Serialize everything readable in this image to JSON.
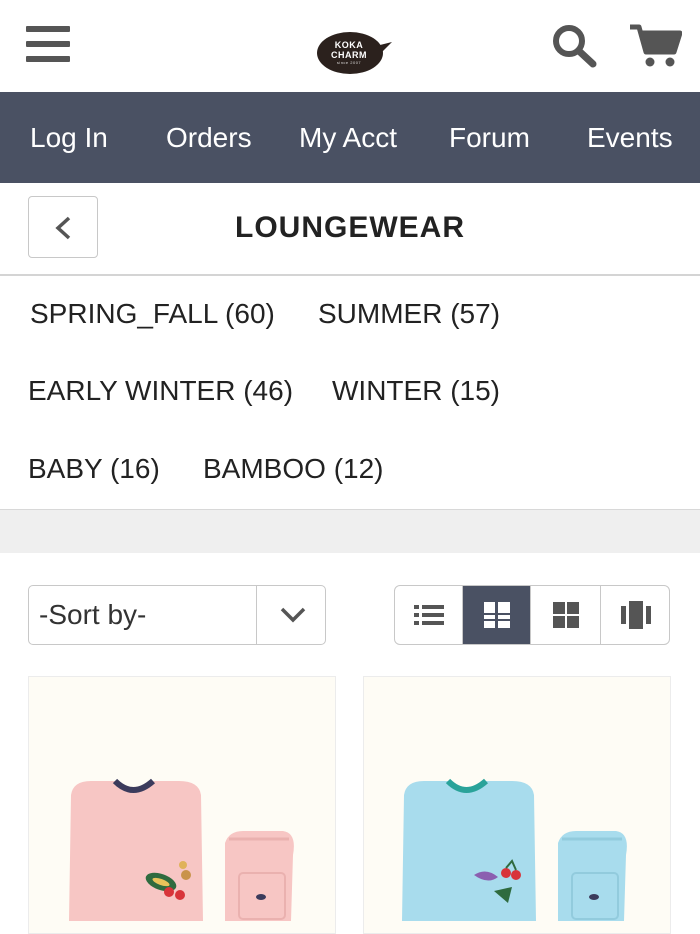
{
  "header": {
    "menu_icon": "hamburger-menu-icon",
    "logo": {
      "line1": "KOKA",
      "line2": "CHARM",
      "tagline": "since 2007"
    },
    "search_icon": "search-icon",
    "cart_icon": "cart-icon"
  },
  "nav": {
    "items": [
      {
        "label": "Log In"
      },
      {
        "label": "Orders"
      },
      {
        "label": "My Acct"
      },
      {
        "label": "Forum"
      },
      {
        "label": "Events"
      }
    ]
  },
  "page": {
    "back_icon": "chevron-left-icon",
    "title": "LOUNGEWEAR"
  },
  "categories": [
    {
      "label": "SPRING_FALL (60)"
    },
    {
      "label": "SUMMER (57)"
    },
    {
      "label": "EARLY WINTER (46)"
    },
    {
      "label": "WINTER (15)"
    },
    {
      "label": "BABY (16)"
    },
    {
      "label": "BAMBOO (12)"
    }
  ],
  "sort": {
    "value": "-Sort by-",
    "icon": "chevron-down-icon"
  },
  "view_modes": [
    {
      "icon": "list-view-icon",
      "active": false
    },
    {
      "icon": "large-grid-view-icon",
      "active": true
    },
    {
      "icon": "small-grid-view-icon",
      "active": false
    },
    {
      "icon": "carousel-view-icon",
      "active": false
    }
  ],
  "colors": {
    "nav_bg": "#4a5163",
    "active_view_bg": "#4a5163",
    "product1_garment": "#f7c6c4",
    "product2_garment": "#a8dced"
  },
  "products": [
    {
      "image": "pink loungewear set with cherry applique"
    },
    {
      "image": "light blue loungewear set with cherry applique"
    }
  ]
}
